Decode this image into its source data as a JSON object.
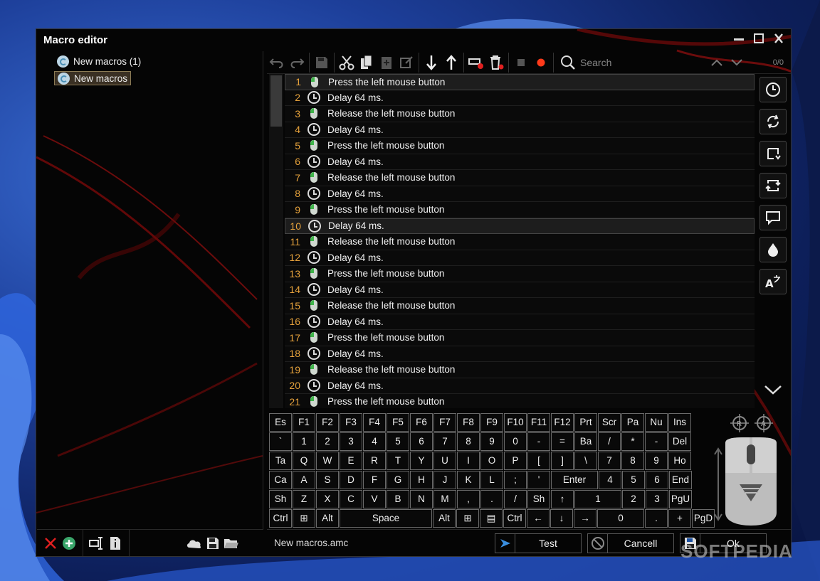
{
  "window": {
    "title": "Macro editor"
  },
  "tree": {
    "items": [
      {
        "label": "New macros (1)"
      },
      {
        "label": "New macros"
      }
    ]
  },
  "search": {
    "placeholder": "Search",
    "count": "0/0"
  },
  "rows": [
    {
      "num": "1",
      "type": "mouse",
      "text": "Press the left mouse button"
    },
    {
      "num": "2",
      "type": "clock",
      "text": "Delay 64 ms."
    },
    {
      "num": "3",
      "type": "mouse",
      "text": "Release the left mouse button"
    },
    {
      "num": "4",
      "type": "clock",
      "text": "Delay 64 ms."
    },
    {
      "num": "5",
      "type": "mouse",
      "text": "Press the left mouse button"
    },
    {
      "num": "6",
      "type": "clock",
      "text": "Delay 64 ms."
    },
    {
      "num": "7",
      "type": "mouse",
      "text": "Release the left mouse button"
    },
    {
      "num": "8",
      "type": "clock",
      "text": "Delay 64 ms."
    },
    {
      "num": "9",
      "type": "mouse",
      "text": "Press the left mouse button"
    },
    {
      "num": "10",
      "type": "clock",
      "text": "Delay 64 ms."
    },
    {
      "num": "11",
      "type": "mouse",
      "text": "Release the left mouse button"
    },
    {
      "num": "12",
      "type": "clock",
      "text": "Delay 64 ms."
    },
    {
      "num": "13",
      "type": "mouse",
      "text": "Press the left mouse button"
    },
    {
      "num": "14",
      "type": "clock",
      "text": "Delay 64 ms."
    },
    {
      "num": "15",
      "type": "mouse",
      "text": "Release the left mouse button"
    },
    {
      "num": "16",
      "type": "clock",
      "text": "Delay 64 ms."
    },
    {
      "num": "17",
      "type": "mouse",
      "text": "Press the left mouse button"
    },
    {
      "num": "18",
      "type": "clock",
      "text": "Delay 64 ms."
    },
    {
      "num": "19",
      "type": "mouse",
      "text": "Release the left mouse button"
    },
    {
      "num": "20",
      "type": "clock",
      "text": "Delay 64 ms."
    },
    {
      "num": "21",
      "type": "mouse",
      "text": "Press the left mouse button"
    }
  ],
  "keyboard": {
    "rows": [
      [
        "Es",
        "F1",
        "F2",
        "F3",
        "F4",
        "F5",
        "F6",
        "F7",
        "F8",
        "F9",
        "F10",
        "F11",
        "F12",
        "Prt",
        "Scr",
        "Pa",
        "Nu",
        "Ins"
      ],
      [
        "`",
        "1",
        "2",
        "3",
        "4",
        "5",
        "6",
        "7",
        "8",
        "9",
        "0",
        "-",
        "=",
        "Ba",
        "/",
        "*",
        "-",
        "Del"
      ],
      [
        "Ta",
        "Q",
        "W",
        "E",
        "R",
        "T",
        "Y",
        "U",
        "I",
        "O",
        "P",
        "[",
        "]",
        "\\",
        "7",
        "8",
        "9",
        "Ho"
      ],
      [
        "Ca",
        "A",
        "S",
        "D",
        "F",
        "G",
        "H",
        "J",
        "K",
        "L",
        ";",
        "'",
        "Enter",
        "4",
        "5",
        "6",
        "End"
      ],
      [
        "Sh",
        "Z",
        "X",
        "C",
        "V",
        "B",
        "N",
        "M",
        ",",
        ".",
        "/",
        "Sh",
        "↑",
        "1",
        "2",
        "3",
        "PgU"
      ],
      [
        "Ctrl",
        "⊞",
        "Alt",
        "Space",
        "Alt",
        "⊞",
        "▤",
        "Ctrl",
        "←",
        "↓",
        "→",
        "0",
        ".",
        "+",
        "PgD"
      ]
    ]
  },
  "bottom": {
    "filename": "New macros.amc",
    "test_label": "Test",
    "cancel_label": "Cancell",
    "ok_label": "Ok"
  },
  "watermark": "SOFTPEDIA"
}
